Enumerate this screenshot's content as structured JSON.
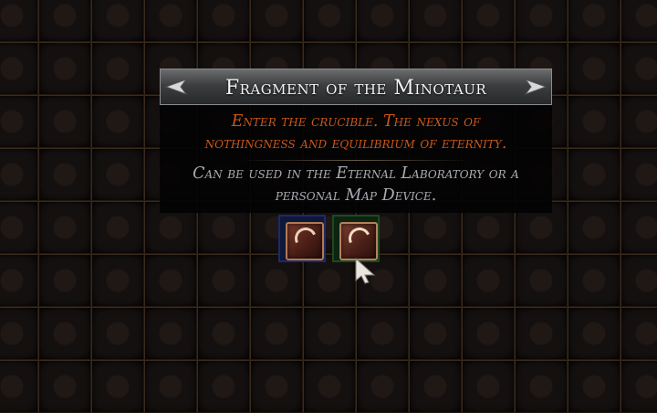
{
  "tooltip": {
    "title": "Fragment of the Minotaur",
    "flavour_lines": [
      "Enter the crucible. The nexus of",
      "nothingness and equilibrium of eternity."
    ],
    "usage_lines": [
      "Can be used in the Eternal Laboratory or a",
      "personal Map Device."
    ]
  },
  "inventory": {
    "columns": 13,
    "rows": 8,
    "items": [
      {
        "name": "fragment-item",
        "highlight": "blue",
        "icon": "map-fragment-icon"
      },
      {
        "name": "fragment-item",
        "highlight": "green",
        "icon": "map-fragment-icon"
      }
    ]
  },
  "colors": {
    "title_text": "#f2f2f2",
    "flavour_text": "#c8571a",
    "usage_text": "#a9acb2",
    "highlight_blue": "#1e2a66",
    "highlight_green": "#1c4a20"
  },
  "cursor": {
    "icon": "pointer-cursor-icon"
  }
}
